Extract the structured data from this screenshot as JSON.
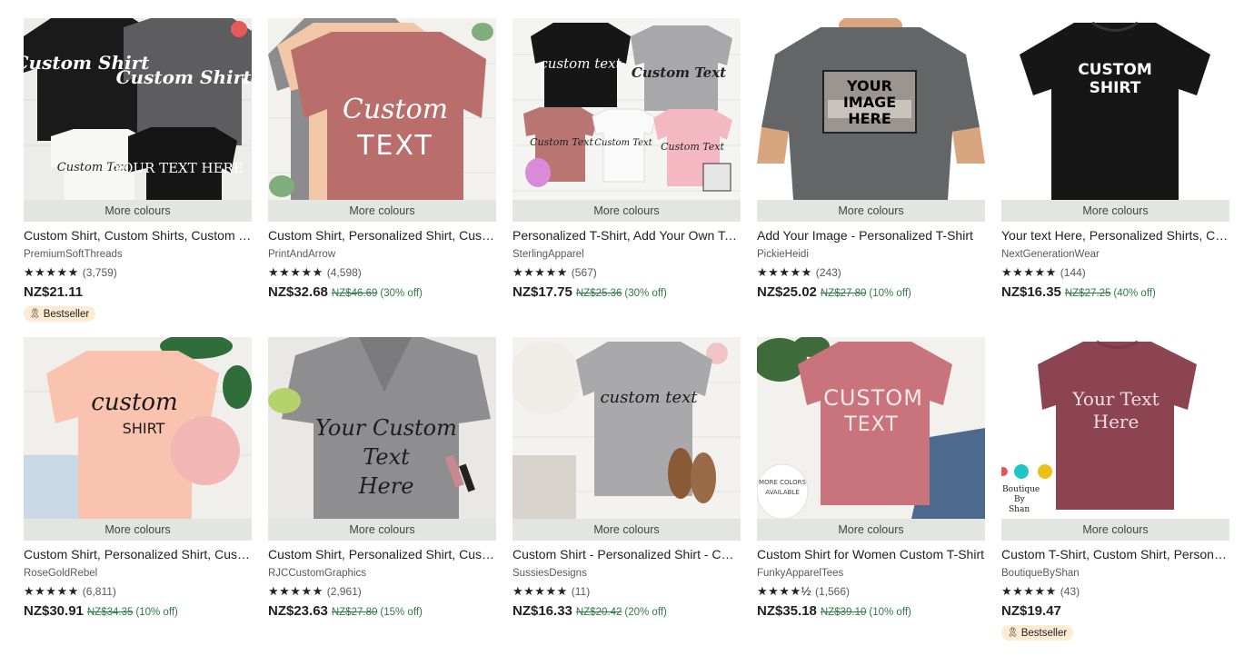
{
  "more_colours_label": "More colours",
  "products": [
    {
      "title": "Custom Shirt, Custom Shirts, Custom T-Shirts",
      "shop": "PremiumSoftThreads",
      "stars": "★★★★★",
      "reviews": "(3,759)",
      "price": "NZ$21.11",
      "original_price": "",
      "discount": "",
      "badge": "Bestseller",
      "badge_icon": "bestseller-ribbon-icon",
      "image_texts": [
        "Custom Shirt",
        "Custom Shirt",
        "Custom Text",
        "YOUR TEXT HERE"
      ]
    },
    {
      "title": "Custom Shirt, Personalized Shirt, Custom Text",
      "shop": "PrintAndArrow",
      "stars": "★★★★★",
      "reviews": "(4,598)",
      "price": "NZ$32.68",
      "original_price": "NZ$46.69",
      "discount": "(30% off)",
      "badge": "",
      "image_texts": [
        "Custom",
        "TEXT"
      ]
    },
    {
      "title": "Personalized T-Shirt, Add Your Own Text",
      "shop": "SterlingApparel",
      "stars": "★★★★★",
      "reviews": "(567)",
      "price": "NZ$17.75",
      "original_price": "NZ$25.36",
      "discount": "(30% off)",
      "badge": "",
      "image_texts": [
        "custom text",
        "Custom Text",
        "Custom Text",
        "Custom Text",
        "Custom Text"
      ]
    },
    {
      "title": "Add Your Image - Personalized T-Shirt",
      "shop": "PickieHeidi",
      "stars": "★★★★★",
      "reviews": "(243)",
      "price": "NZ$25.02",
      "original_price": "NZ$27.80",
      "discount": "(10% off)",
      "badge": "",
      "image_texts": [
        "YOUR",
        "IMAGE",
        "HERE"
      ]
    },
    {
      "title": "Your text Here, Personalized Shirts, Custom",
      "shop": "NextGenerationWear",
      "stars": "★★★★★",
      "reviews": "(144)",
      "price": "NZ$16.35",
      "original_price": "NZ$27.25",
      "discount": "(40% off)",
      "badge": "",
      "image_texts": [
        "CUSTOM",
        "SHIRT"
      ]
    },
    {
      "title": "Custom Shirt, Personalized Shirt, Custom",
      "shop": "RoseGoldRebel",
      "stars": "★★★★★",
      "reviews": "(6,811)",
      "price": "NZ$30.91",
      "original_price": "NZ$34.35",
      "discount": "(10% off)",
      "badge": "",
      "image_texts": [
        "custom",
        "SHIRT"
      ]
    },
    {
      "title": "Custom Shirt, Personalized Shirt, Custom",
      "shop": "RJCCustomGraphics",
      "stars": "★★★★★",
      "reviews": "(2,961)",
      "price": "NZ$23.63",
      "original_price": "NZ$27.80",
      "discount": "(15% off)",
      "badge": "",
      "image_texts": [
        "Your Custom",
        "Text",
        "Here"
      ]
    },
    {
      "title": "Custom Shirt - Personalized Shirt - Custom",
      "shop": "SussiesDesigns",
      "stars": "★★★★★",
      "reviews": "(11)",
      "price": "NZ$16.33",
      "original_price": "NZ$20.42",
      "discount": "(20% off)",
      "badge": "",
      "image_texts": [
        "custom text"
      ]
    },
    {
      "title": "Custom Shirt for Women Custom T-Shirt",
      "shop": "FunkyApparelTees",
      "stars": "★★★★½",
      "reviews": "(1,566)",
      "price": "NZ$35.18",
      "original_price": "NZ$39.10",
      "discount": "(10% off)",
      "badge": "",
      "image_texts": [
        "CUSTOM",
        "TEXT",
        "MORE COLORS",
        "AVAILABLE"
      ]
    },
    {
      "title": "Custom T-Shirt, Custom Shirt, Personalized",
      "shop": "BoutiqueByShan",
      "stars": "★★★★★",
      "reviews": "(43)",
      "price": "NZ$19.47",
      "original_price": "",
      "discount": "",
      "badge": "Bestseller",
      "badge_icon": "bestseller-ribbon-icon",
      "image_texts": [
        "Your Text",
        "Here",
        "Boutique",
        "By",
        "Shan"
      ]
    }
  ],
  "colors": {
    "discount_green": "#2f7a46",
    "more_colours_bg": "#e3e5e0",
    "badge_bg": "#fdebd2"
  }
}
